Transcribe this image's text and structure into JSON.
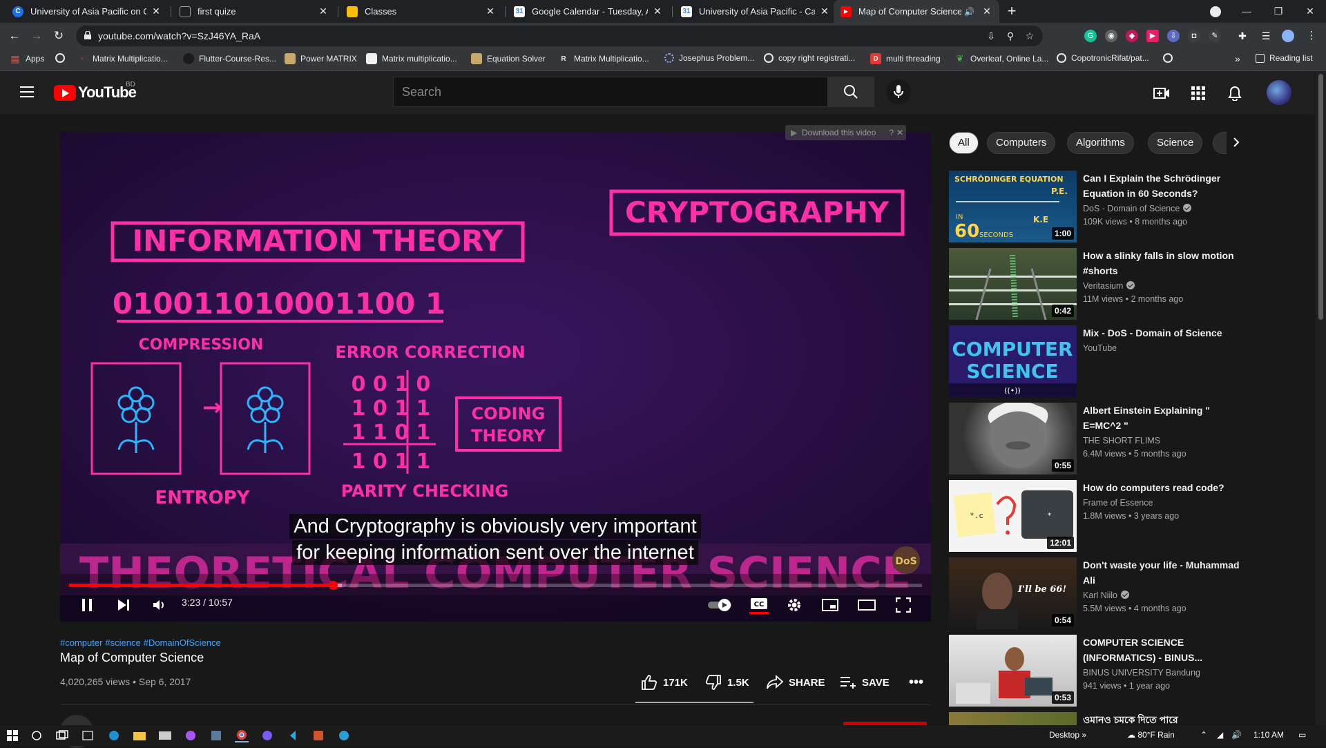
{
  "browser": {
    "tabs": [
      {
        "title": "University of Asia Pacific on Cou",
        "icon": "C",
        "color": "#1a73e8",
        "active": false
      },
      {
        "title": "first quize",
        "icon": "▣",
        "color": "#9aa0a6",
        "active": false
      },
      {
        "title": "Classes",
        "icon": "▣",
        "color": "#fbbc04",
        "active": false
      },
      {
        "title": "Google Calendar - Tuesday, Augu",
        "icon": "31",
        "color": "#4285f4",
        "active": false
      },
      {
        "title": "University of Asia Pacific - Calend",
        "icon": "31",
        "color": "#4285f4",
        "active": false
      },
      {
        "title": "Map of Computer Science -",
        "icon": "▶",
        "color": "#ff0000",
        "active": true
      }
    ],
    "url": "youtube.com/watch?v=SzJ46YA_RaA",
    "bookmarks": [
      {
        "label": "Apps",
        "icon": "▦",
        "color": "#ea4335"
      },
      {
        "label": "",
        "icon": "◐",
        "color": "#e8eaed"
      },
      {
        "label": "Matrix Multiplicatio...",
        "icon": "▪",
        "color": "#c2185b"
      },
      {
        "label": "Flutter-Course-Res...",
        "icon": "◉",
        "color": "#1b1b1b"
      },
      {
        "label": "Power MATRIX",
        "icon": "▬",
        "color": "#c8a96a"
      },
      {
        "label": "Matrix multiplicatio...",
        "icon": "▨",
        "color": "#f1f1f1"
      },
      {
        "label": "Equation Solver",
        "icon": "▬",
        "color": "#c8a96a"
      },
      {
        "label": "Matrix Multiplicatio...",
        "icon": "R",
        "color": "#e8eaed"
      },
      {
        "label": "Josephus Problem...",
        "icon": "◌",
        "color": "#8ab4f8"
      },
      {
        "label": "copy right registrati...",
        "icon": "◉",
        "color": "#e8eaed"
      },
      {
        "label": "multi threading",
        "icon": "D",
        "color": "#e53935"
      },
      {
        "label": "Overleaf, Online La...",
        "icon": "❦",
        "color": "#4caf50"
      },
      {
        "label": "CopotronicRifat/pat...",
        "icon": "◉",
        "color": "#e8eaed"
      },
      {
        "label": "",
        "icon": "◐",
        "color": "#e8eaed"
      }
    ],
    "reading_list": "Reading list",
    "more_bookmarks": "»"
  },
  "youtube": {
    "country": "BD",
    "wordmark": "YouTube",
    "search_placeholder": "Search",
    "player": {
      "download_label": "Download this video",
      "subtitle_line1": "And Cryptography is obviously very important",
      "subtitle_line2": "for keeping information sent over the internet",
      "timecode": "3:23 / 10:57",
      "progress_fraction": 0.309,
      "buffer_fraction": 0.32,
      "frame": {
        "info_theory": "INFORMATION THEORY",
        "binary": "010011010001100 1",
        "compression": "COMPRESSION",
        "error_correction": "ERROR CORRECTION",
        "matrix": [
          "0 0 1 0",
          "1 0 1 1",
          "1 1 0 1",
          "1 0 1 1"
        ],
        "coding_theory_1": "CODING",
        "coding_theory_2": "THEORY",
        "entropy": "ENTROPY",
        "parity": "PARITY CHECKING",
        "cryptography": "CRYPTOGRAPHY",
        "banner": "THEORETICAL COMPUTER SCIENCE",
        "watermark": "DoS"
      }
    },
    "video": {
      "hashtags": [
        "#computer",
        "#science",
        "#DomainOfScience"
      ],
      "title": "Map of Computer Science",
      "meta": "4,020,265 views • Sep 6, 2017",
      "likes": "171K",
      "dislikes": "1.5K",
      "share": "SHARE",
      "save": "SAVE",
      "like_ratio": 0.99
    },
    "chips": [
      "All",
      "Computers",
      "Algorithms",
      "Science"
    ],
    "recommendations": [
      {
        "title": "Can I Explain the Schrödinger Equation in 60 Seconds?",
        "channel": "DoS - Domain of Science",
        "verified": true,
        "views": "109K views • 8 months ago",
        "duration": "1:00",
        "thumb": "schrodinger"
      },
      {
        "title": "How a slinky falls in slow motion #shorts",
        "channel": "Veritasium",
        "verified": true,
        "views": "11M views • 2 months ago",
        "duration": "0:42",
        "thumb": "slinky"
      },
      {
        "title": "Mix - DoS - Domain of Science",
        "channel": "YouTube",
        "verified": false,
        "views": "",
        "duration": "",
        "thumb": "mix"
      },
      {
        "title": "Albert Einstein Explaining \" E=MC^2 \"",
        "channel": "THE SHORT FLIMS",
        "verified": false,
        "views": "6.4M views • 5 months ago",
        "duration": "0:55",
        "thumb": "einstein"
      },
      {
        "title": "How do computers read code?",
        "channel": "Frame of Essence",
        "verified": false,
        "views": "1.8M views • 3 years ago",
        "duration": "12:01",
        "thumb": "code"
      },
      {
        "title": "Don't waste your life - Muhammad Ali",
        "channel": "Karl Niilo",
        "verified": true,
        "views": "5.5M views • 4 months ago",
        "duration": "0:54",
        "thumb": "ali"
      },
      {
        "title": "COMPUTER SCIENCE (INFORMATICS) - BINUS...",
        "channel": "BINUS UNIVERSITY Bandung",
        "verified": false,
        "views": "941 views • 1 year ago",
        "duration": "0:53",
        "thumb": "binus"
      },
      {
        "title": "ওমানও চমকে দিতে পারে",
        "channel": "",
        "verified": false,
        "views": "",
        "duration": "",
        "thumb": "last"
      }
    ],
    "thumb_text": {
      "schrodinger_title": "SCHRÖDINGER EQUATION",
      "schrodinger_in": "IN",
      "schrodinger_60": "60",
      "schrodinger_seconds": "SECONDS",
      "schrodinger_pe": "P.E.",
      "schrodinger_ke": "K.E",
      "mix_1": "COMPUTER",
      "mix_2": "SCIENCE",
      "mix_live": "((•))",
      "code_1": "*.c",
      "code_2": "*",
      "ali_text": "I'll be 66!"
    }
  },
  "taskbar": {
    "desktop": "Desktop",
    "weather": "80°F  Rain",
    "time": "1:10 AM"
  }
}
